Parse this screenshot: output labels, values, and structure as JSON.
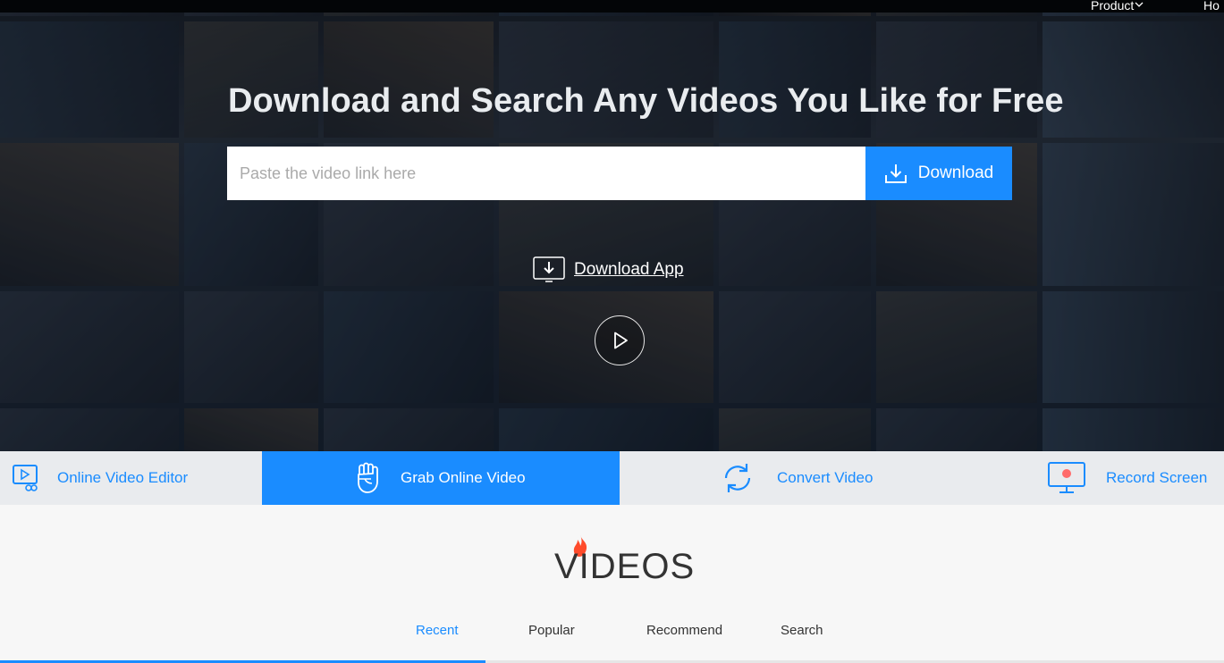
{
  "nav": {
    "product": "Product",
    "home": "Ho"
  },
  "hero": {
    "title": "Download and Search Any Videos You Like for Free",
    "search_placeholder": "Paste the video link here",
    "download_button": "Download",
    "download_app": "Download App"
  },
  "tools": [
    {
      "label": "Online Video Editor",
      "active": false
    },
    {
      "label": "Grab Online Video",
      "active": true
    },
    {
      "label": "Convert Video",
      "active": false
    },
    {
      "label": "Record Screen",
      "active": false
    }
  ],
  "videos": {
    "heading": "VIDEOS",
    "tabs": [
      "Recent",
      "Popular",
      "Recommend",
      "Search"
    ],
    "active_tab": "Recent"
  },
  "colors": {
    "accent": "#1a8cff",
    "flame": "#ff4b2b"
  }
}
